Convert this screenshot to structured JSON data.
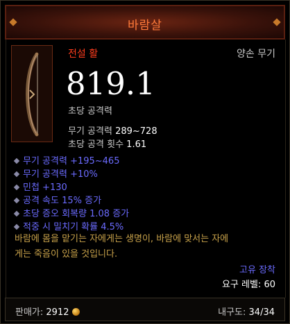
{
  "item": {
    "name": "바람살",
    "quality": "전설 활",
    "slot": "양손 무기",
    "dps": "819.1",
    "dps_label": "초당 공격력",
    "damage_label": "무기 공격력",
    "damage_value": "289~728",
    "aps_label": "초당 공격 횟수",
    "aps_value": "1.61",
    "icon": "bow-icon"
  },
  "affixes": [
    "무기 공격력 +195~465",
    "무기 공격력 +10%",
    "민첩 +130",
    "공격 속도 15% 증가",
    "초당 증오 회복량 1.08 증가",
    "적중 시 밀치기 확률 4.5%"
  ],
  "flavor_lines": [
    "바람에 몸을 맡기는 자에게는 생명이, 바람에 맞서는 자에",
    "게는 죽음이 있을 것입니다."
  ],
  "requirements": {
    "bind": "고유 장착",
    "level_label": "요구 레벨:",
    "level_value": "60"
  },
  "footer": {
    "sell_label": "판매가:",
    "sell_value": "2912",
    "durability_label": "내구도:",
    "durability_value": "34/34"
  },
  "colors": {
    "title": "#ff7a3a",
    "legendary": "#ff3d1d",
    "affix": "#6b6bff",
    "flavor": "#c8a24a"
  }
}
